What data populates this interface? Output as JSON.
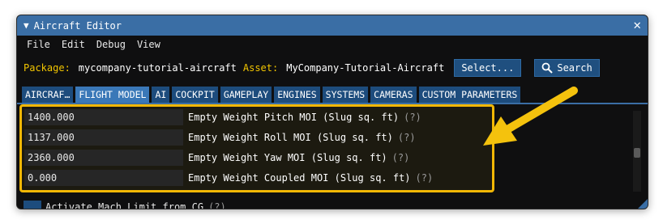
{
  "window": {
    "title": "Aircraft Editor",
    "collapse_glyph": "▼",
    "close_glyph": "✕"
  },
  "menu": [
    "File",
    "Edit",
    "Debug",
    "View"
  ],
  "package": {
    "package_label": "Package:",
    "package_value": "mycompany-tutorial-aircraft",
    "asset_label": "Asset:",
    "asset_value": "MyCompany-Tutorial-Aircraft",
    "select_label": "Select...",
    "search_label": "Search"
  },
  "tabs": [
    {
      "label": "AIRCRAF…",
      "active": false,
      "modified": true
    },
    {
      "label": "FLIGHT MODEL",
      "active": true
    },
    {
      "label": "AI",
      "active": false
    },
    {
      "label": "COCKPIT",
      "active": false
    },
    {
      "label": "GAMEPLAY",
      "active": false
    },
    {
      "label": "ENGINES",
      "active": false
    },
    {
      "label": "SYSTEMS",
      "active": false
    },
    {
      "label": "CAMERAS",
      "active": false
    },
    {
      "label": "CUSTOM PARAMETERS",
      "active": false
    }
  ],
  "rows": [
    {
      "value": "1400.000",
      "label": "Empty Weight Pitch MOI (Slug sq. ft)",
      "help": "(?)"
    },
    {
      "value": "1137.000",
      "label": "Empty Weight Roll MOI (Slug sq. ft)",
      "help": "(?)"
    },
    {
      "value": "2360.000",
      "label": "Empty Weight Yaw MOI (Slug sq. ft)",
      "help": "(?)"
    },
    {
      "value": "0.000",
      "label": "Empty Weight Coupled MOI (Slug sq. ft)",
      "help": "(?)"
    }
  ],
  "partial_row": {
    "label": "Activate Mach Limit from CG",
    "help": "(?)"
  },
  "colors": {
    "titlebar": "#3a6ea5",
    "tab": "#1d4c7d",
    "tab_active": "#3a78b8",
    "highlight": "#f2b705",
    "package_label": "#f2c500",
    "arrow": "#f4c20d"
  },
  "icons": {
    "search": "search-icon",
    "close": "close-icon",
    "collapse": "collapse-triangle-icon",
    "arrow": "callout-arrow-icon"
  }
}
